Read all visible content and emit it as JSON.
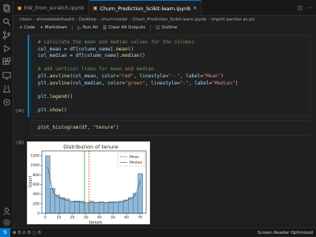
{
  "tabs": [
    {
      "label": "EW_from_scratch.ipynb",
      "active": false
    },
    {
      "label": "Churn_Prediction_Scikit-learn.ipynb",
      "active": true
    }
  ],
  "breadcrumb": [
    "Users",
    "ahmedabdelhadid",
    "Desktop",
    "churn-model",
    "Churn_Prediction_Scikit-learn.ipynb",
    "import pandas as pd"
  ],
  "toolbar": {
    "code": "+ Code",
    "markdown": "+ Markdown",
    "run_all": "Run All",
    "clear_outputs": "Clear All Outputs",
    "outline": "Outline"
  },
  "cell1": {
    "exec_count": "[46]",
    "lines": [
      {
        "type": "comment",
        "text": "# calculate the mean and median values for the columns"
      },
      {
        "type": "code",
        "text": "col_mean = df[column_name].mean()"
      },
      {
        "type": "code",
        "text": "col_median = df[column_name].median()"
      },
      {
        "type": "blank",
        "text": ""
      },
      {
        "type": "comment",
        "text": "# add vertical lines for mean and median"
      },
      {
        "type": "code",
        "text": "plt.axvline(col_mean, color=\"red\", linestyle=\"--\", label=\"Mean\")"
      },
      {
        "type": "code",
        "text": "plt.axvline(col_median, color=\"green\", linestyle=\"-\", label=\"Median\")"
      },
      {
        "type": "blank",
        "text": ""
      },
      {
        "type": "code",
        "text": "plt.legend()"
      },
      {
        "type": "blank",
        "text": ""
      },
      {
        "type": "code",
        "text": "plt.show()"
      }
    ]
  },
  "cell2": {
    "exec_count": "[48]",
    "code": "plot_histogram(df, \"tenure\")"
  },
  "chart_data": {
    "type": "bar",
    "title": "Distribution of tenure",
    "xlabel": "tenure",
    "ylabel": "Count",
    "xlim": [
      0,
      72
    ],
    "ylim": [
      0,
      1300
    ],
    "xticks": [
      "0",
      "10",
      "20",
      "30",
      "40",
      "50",
      "60",
      "70"
    ],
    "yticks": [
      "0",
      "200",
      "400",
      "600",
      "800",
      "1000",
      "1200"
    ],
    "bin_edges": [
      0,
      3.6,
      7.2,
      10.8,
      14.4,
      18,
      21.6,
      25.2,
      28.8,
      32.4,
      36,
      39.6,
      43.2,
      46.8,
      50.4,
      54,
      57.6,
      61.2,
      64.8,
      68.4,
      72
    ],
    "values": [
      1200,
      520,
      380,
      330,
      300,
      250,
      260,
      250,
      220,
      250,
      230,
      240,
      230,
      240,
      240,
      250,
      280,
      330,
      420,
      830
    ],
    "bar_color": "#8fb8d8",
    "kde_color": "#555555",
    "mean": 32.4,
    "median": 29,
    "legend": [
      {
        "label": "Mean",
        "color": "#d62728",
        "style": "dashed"
      },
      {
        "label": "Median",
        "color": "#2ca02c",
        "style": "solid"
      }
    ],
    "legend_position": "top-right"
  },
  "statusbar": {
    "problems": "0",
    "warnings": "0",
    "info": "0",
    "right": "Screen Reader Optimized"
  }
}
